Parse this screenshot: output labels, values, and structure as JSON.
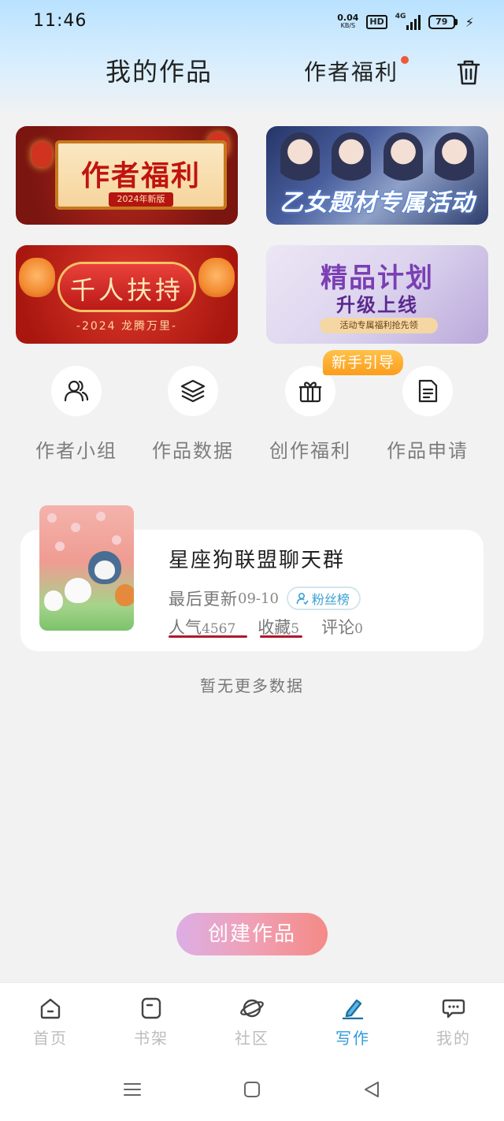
{
  "status_bar": {
    "time": "11:46",
    "net_speed": "0.04",
    "net_unit": "KB/S",
    "hd": "HD",
    "network": "4G",
    "battery": "79"
  },
  "header": {
    "title": "我的作品",
    "welfare_link": "作者福利",
    "welfare_dot_color": "#ef5a3b"
  },
  "banners": [
    {
      "title": "作者福利",
      "subtitle": "2024年新版"
    },
    {
      "title": "乙女题材专属活动"
    },
    {
      "title": "千人扶持",
      "subtitle": "-2024 龙腾万里-"
    },
    {
      "title": "精品计划",
      "subtitle": "升级上线",
      "tag": "活动专属福利抢先领"
    }
  ],
  "quick_actions": [
    {
      "label": "作者小组",
      "icon": "people-icon"
    },
    {
      "label": "作品数据",
      "icon": "layers-icon"
    },
    {
      "label": "创作福利",
      "icon": "gift-icon",
      "badge": "新手引导"
    },
    {
      "label": "作品申请",
      "icon": "document-icon"
    }
  ],
  "work": {
    "title": "星座狗联盟聊天群",
    "last_update_label": "最后更新",
    "last_update_value": "09-10",
    "fans_button": "粉丝榜",
    "stats": [
      {
        "label": "人气",
        "value": "4567"
      },
      {
        "label": "收藏",
        "value": "5"
      },
      {
        "label": "评论",
        "value": "0"
      }
    ]
  },
  "no_more": "暂无更多数据",
  "create_button": "创建作品",
  "tabs": [
    {
      "label": "首页",
      "icon": "home-icon",
      "active": false
    },
    {
      "label": "书架",
      "icon": "bookshelf-icon",
      "active": false
    },
    {
      "label": "社区",
      "icon": "planet-icon",
      "active": false
    },
    {
      "label": "写作",
      "icon": "pen-icon",
      "active": true
    },
    {
      "label": "我的",
      "icon": "chat-icon",
      "active": false
    }
  ],
  "colors": {
    "accent": "#2f9bd8",
    "badge_orange": "#fb9d1c",
    "underline_red": "#b0162d"
  }
}
